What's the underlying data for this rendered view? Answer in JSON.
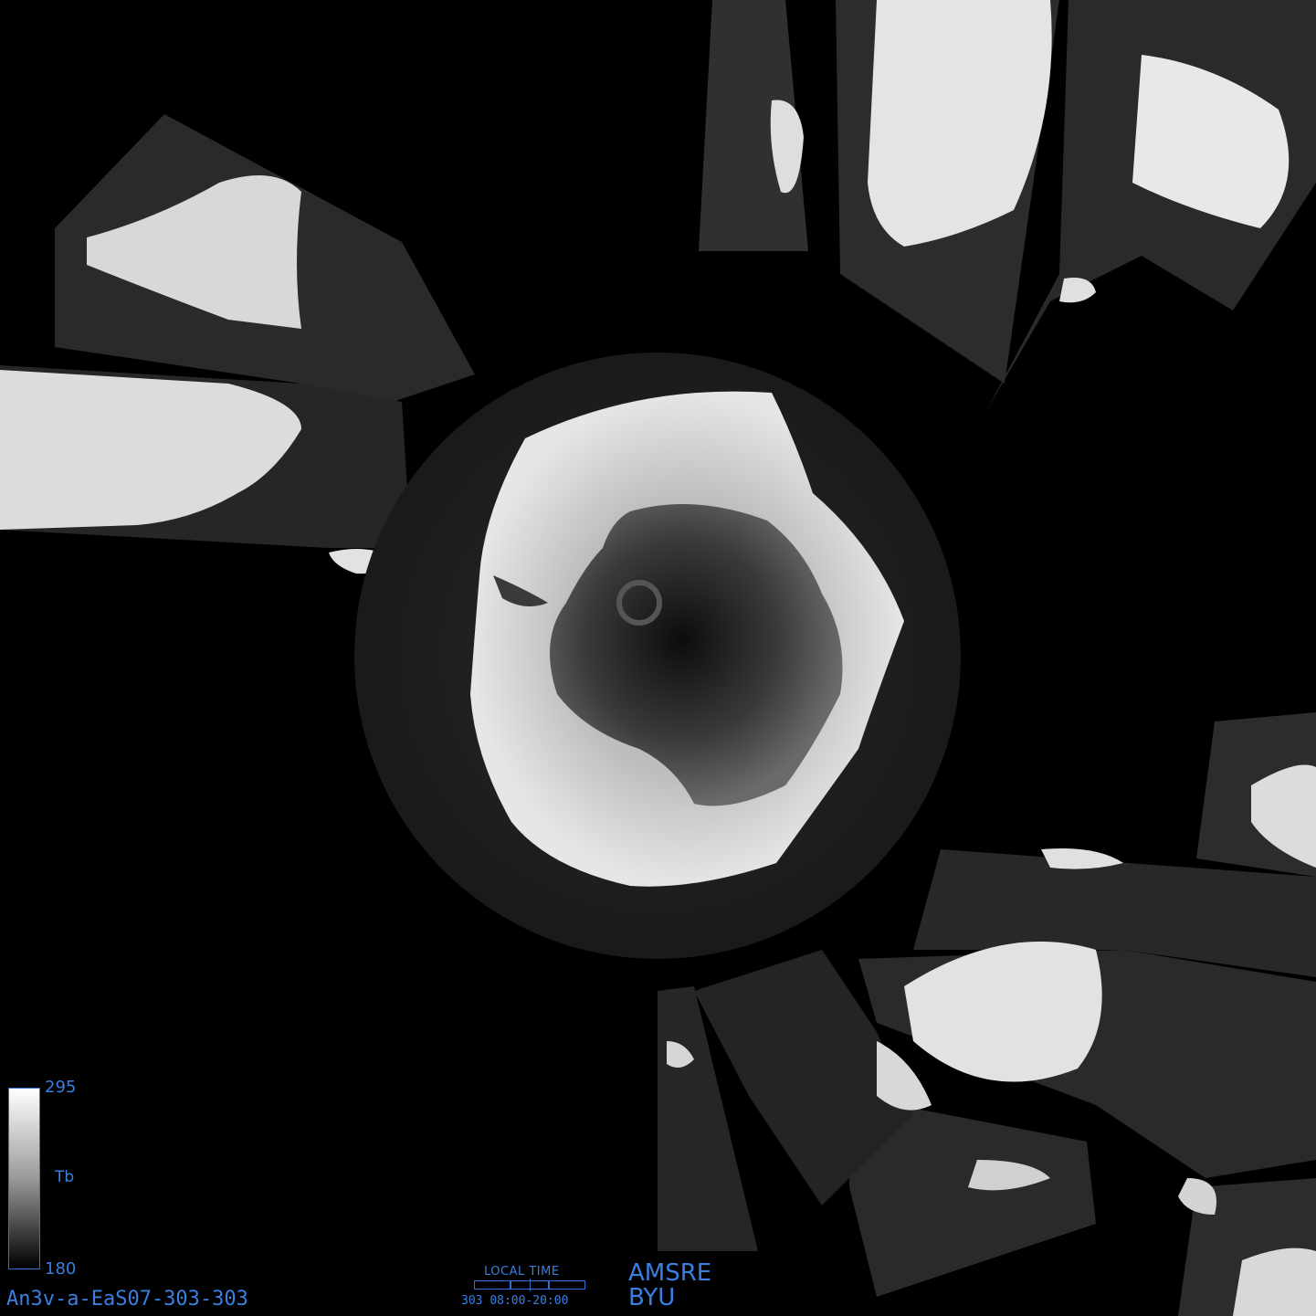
{
  "colorbar": {
    "max_label": "295",
    "min_label": "180",
    "variable_label": "Tb"
  },
  "product_id": "An3v-a-EaS07-303-303",
  "local_time": {
    "title": "LOCAL TIME",
    "day": "303",
    "window": "08:00-20:00"
  },
  "sensor": "AMSRE",
  "organization": "BYU",
  "colors": {
    "overlay_text": "#3a7fe0",
    "background": "#000000"
  }
}
